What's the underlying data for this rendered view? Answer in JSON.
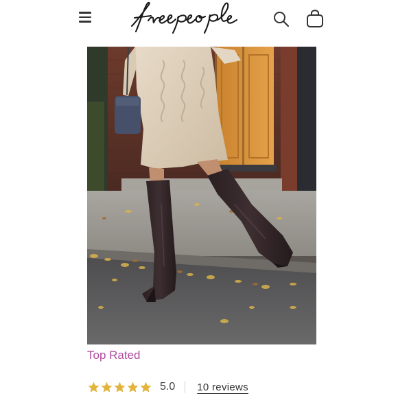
{
  "header": {
    "brand_logo": "free people",
    "icons": [
      "menu-icon",
      "search-icon",
      "shopping-bag-icon"
    ]
  },
  "product": {
    "image_icon": "product-photo",
    "badge": "Top Rated",
    "rating": {
      "stars": 5,
      "value": "5.0",
      "reviews_label": "10 reviews"
    }
  },
  "colors": {
    "badge": "#b14a9c",
    "star": "#e3b43b",
    "text": "#333333"
  }
}
